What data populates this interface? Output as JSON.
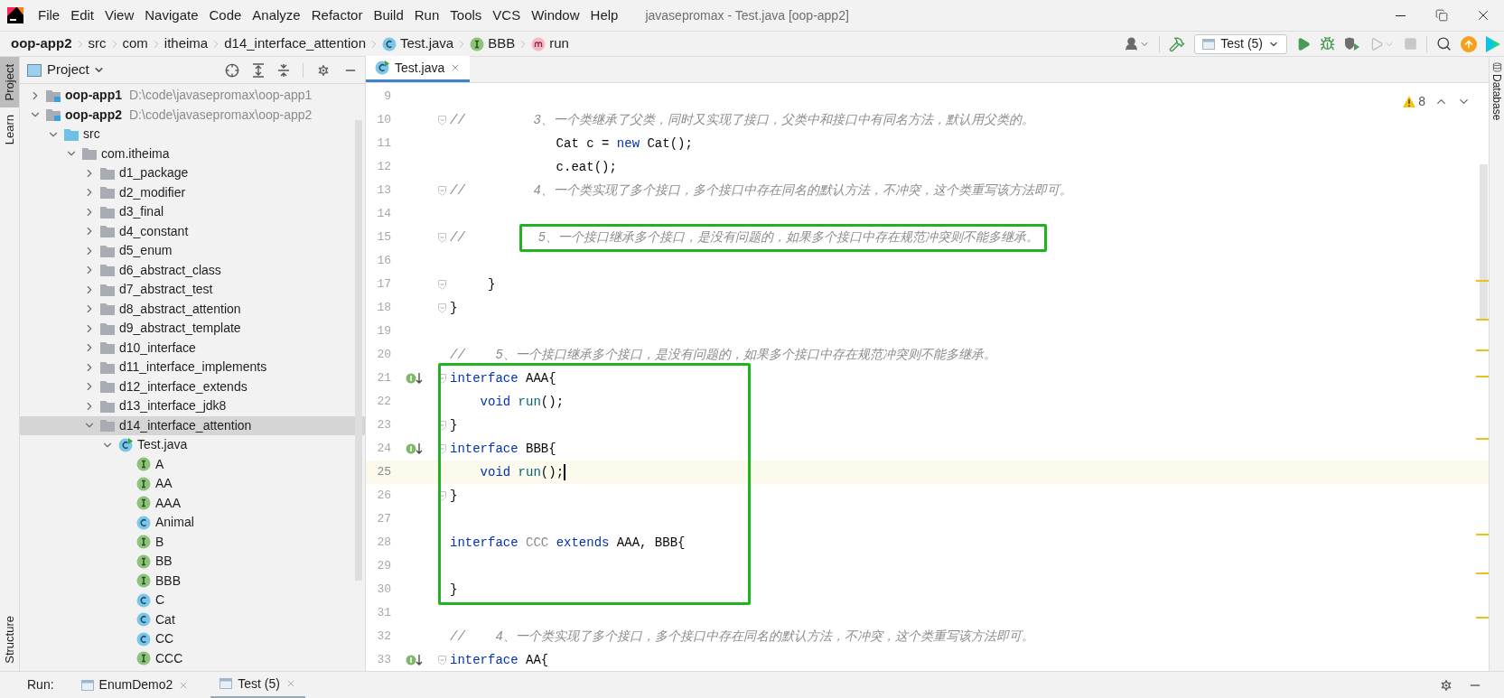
{
  "menu": [
    "File",
    "Edit",
    "View",
    "Navigate",
    "Code",
    "Analyze",
    "Refactor",
    "Build",
    "Run",
    "Tools",
    "VCS",
    "Window",
    "Help"
  ],
  "window": {
    "title": "javasepromax - Test.java [oop-app2]"
  },
  "breadcrumbs": [
    {
      "label": "oop-app2",
      "kind": "project"
    },
    {
      "label": "src",
      "kind": "folder"
    },
    {
      "label": "com",
      "kind": "folder"
    },
    {
      "label": "itheima",
      "kind": "folder"
    },
    {
      "label": "d14_interface_attention",
      "kind": "folder"
    },
    {
      "label": "Test.java",
      "kind": "class"
    },
    {
      "label": "BBB",
      "kind": "interface"
    },
    {
      "label": "run",
      "kind": "method"
    }
  ],
  "toolbar": {
    "run_config": "Test (5)"
  },
  "side_tabs": [
    {
      "label": "Project",
      "selected": true
    },
    {
      "label": "Learn",
      "selected": false
    }
  ],
  "side_tabs_bottom": [
    {
      "label": "Structure",
      "selected": false
    }
  ],
  "right_tabs": [
    {
      "label": "Database",
      "selected": false
    }
  ],
  "project_panel": {
    "title": "Project",
    "tree": [
      {
        "label": "oop-app1",
        "path": "D:\\code\\javasepromax\\oop-app1",
        "kind": "module",
        "expanded": false,
        "selected": false
      },
      {
        "label": "oop-app2",
        "path": "D:\\code\\javasepromax\\oop-app2",
        "kind": "module",
        "expanded": true,
        "selected": false,
        "children": [
          {
            "label": "src",
            "kind": "source",
            "expanded": true,
            "selected": false,
            "children": [
              {
                "label": "com.itheima",
                "kind": "package",
                "expanded": true,
                "selected": false,
                "children": [
                  {
                    "label": "d1_package",
                    "kind": "package",
                    "expanded": false,
                    "selected": false
                  },
                  {
                    "label": "d2_modifier",
                    "kind": "package",
                    "expanded": false,
                    "selected": false
                  },
                  {
                    "label": "d3_final",
                    "kind": "package",
                    "expanded": false,
                    "selected": false
                  },
                  {
                    "label": "d4_constant",
                    "kind": "package",
                    "expanded": false,
                    "selected": false
                  },
                  {
                    "label": "d5_enum",
                    "kind": "package",
                    "expanded": false,
                    "selected": false
                  },
                  {
                    "label": "d6_abstract_class",
                    "kind": "package",
                    "expanded": false,
                    "selected": false
                  },
                  {
                    "label": "d7_abstract_test",
                    "kind": "package",
                    "expanded": false,
                    "selected": false
                  },
                  {
                    "label": "d8_abstract_attention",
                    "kind": "package",
                    "expanded": false,
                    "selected": false
                  },
                  {
                    "label": "d9_abstract_template",
                    "kind": "package",
                    "expanded": false,
                    "selected": false
                  },
                  {
                    "label": "d10_interface",
                    "kind": "package",
                    "expanded": false,
                    "selected": false
                  },
                  {
                    "label": "d11_interface_implements",
                    "kind": "package",
                    "expanded": false,
                    "selected": false
                  },
                  {
                    "label": "d12_interface_extends",
                    "kind": "package",
                    "expanded": false,
                    "selected": false
                  },
                  {
                    "label": "d13_interface_jdk8",
                    "kind": "package",
                    "expanded": false,
                    "selected": false
                  },
                  {
                    "label": "d14_interface_attention",
                    "kind": "package",
                    "expanded": true,
                    "selected": true,
                    "children": [
                      {
                        "label": "Test.java",
                        "kind": "class-file",
                        "expanded": true,
                        "selected": false,
                        "children": [
                          {
                            "label": "A",
                            "kind": "interface",
                            "selected": false
                          },
                          {
                            "label": "AA",
                            "kind": "interface",
                            "selected": false
                          },
                          {
                            "label": "AAA",
                            "kind": "interface",
                            "selected": false
                          },
                          {
                            "label": "Animal",
                            "kind": "class",
                            "selected": false
                          },
                          {
                            "label": "B",
                            "kind": "interface",
                            "selected": false
                          },
                          {
                            "label": "BB",
                            "kind": "interface",
                            "selected": false
                          },
                          {
                            "label": "BBB",
                            "kind": "interface",
                            "selected": false
                          },
                          {
                            "label": "C",
                            "kind": "class",
                            "selected": false
                          },
                          {
                            "label": "Cat",
                            "kind": "class",
                            "selected": false
                          },
                          {
                            "label": "CC",
                            "kind": "class",
                            "selected": false
                          },
                          {
                            "label": "CCC",
                            "kind": "interface",
                            "selected": false
                          }
                        ]
                      }
                    ]
                  }
                ]
              }
            ]
          }
        ]
      }
    ]
  },
  "editor": {
    "tabs": [
      {
        "label": "Test.java",
        "selected": true
      }
    ],
    "warnings": "8",
    "blocks": [
      {
        "lines": [
          {
            "number": "9"
          },
          {
            "number": "10",
            "fold": true,
            "tokens": [
              {
                "kind": "comment",
                "text": "//         3、一个类继承了父类，同时又实现了接口，父类中和接口中有同名方法，默认用父类的。"
              }
            ]
          },
          {
            "number": "11",
            "tokens": [
              {
                "kind": "plain",
                "text": "              Cat c = "
              },
              {
                "kind": "keyword",
                "text": "new"
              },
              {
                "kind": "plain",
                "text": " Cat();"
              }
            ]
          },
          {
            "number": "12",
            "tokens": [
              {
                "kind": "plain",
                "text": "              c.eat();"
              }
            ]
          },
          {
            "number": "13",
            "fold": true,
            "tokens": [
              {
                "kind": "comment",
                "text": "//         4、一个类实现了多个接口，多个接口中存在同名的默认方法，不冲突，这个类重写该方法即可。"
              }
            ]
          },
          {
            "number": "14"
          },
          {
            "number": "15",
            "fold": true,
            "tokens": [
              {
                "kind": "comment",
                "text": "//"
              },
              {
                "kind": "comment",
                "boxed": true,
                "text": "5、一个接口继承多个接口，是没有问题的，如果多个接口中存在规范冲突则不能多继承。"
              }
            ]
          },
          {
            "number": "16"
          },
          {
            "number": "17",
            "fold": true,
            "tokens": [
              {
                "kind": "plain",
                "text": "     }"
              }
            ]
          },
          {
            "number": "18",
            "fold": true,
            "tokens": [
              {
                "kind": "plain",
                "text": "}"
              }
            ]
          },
          {
            "number": "19"
          },
          {
            "number": "20",
            "tokens": [
              {
                "kind": "comment",
                "text": "//    5、一个接口继承多个接口，是没有问题的，如果多个接口中存在规范冲突则不能多继承。"
              }
            ]
          }
        ]
      },
      {
        "boxed": true,
        "lines": [
          {
            "number": "21",
            "fold": true,
            "implemented": true,
            "tokens": [
              {
                "kind": "keyword",
                "text": "interface"
              },
              {
                "kind": "plain",
                "text": " AAA{"
              }
            ]
          },
          {
            "number": "22",
            "tokens": [
              {
                "kind": "keyword",
                "text": "    void"
              },
              {
                "kind": "method",
                "text": " run"
              },
              {
                "kind": "plain",
                "text": "();"
              }
            ]
          },
          {
            "number": "23",
            "fold": true,
            "tokens": [
              {
                "kind": "plain",
                "text": "}"
              }
            ]
          },
          {
            "number": "24",
            "fold": true,
            "implemented": true,
            "tokens": [
              {
                "kind": "keyword",
                "text": "interface"
              },
              {
                "kind": "plain",
                "text": " BBB{"
              }
            ]
          },
          {
            "number": "25",
            "current": true,
            "caret": true,
            "tokens": [
              {
                "kind": "keyword",
                "text": "    void"
              },
              {
                "kind": "method",
                "text": " run"
              },
              {
                "kind": "plain",
                "text": "();"
              }
            ]
          },
          {
            "number": "26",
            "fold": true,
            "tokens": [
              {
                "kind": "plain",
                "text": "}"
              }
            ]
          },
          {
            "number": "27"
          },
          {
            "number": "28",
            "tokens": [
              {
                "kind": "keyword",
                "text": "interface"
              },
              {
                "kind": "unused",
                "text": " CCC"
              },
              {
                "kind": "keyword",
                "text": " extends"
              },
              {
                "kind": "plain",
                "text": " AAA, BBB{"
              }
            ]
          },
          {
            "number": "29"
          },
          {
            "number": "30",
            "tokens": [
              {
                "kind": "plain",
                "text": "}"
              }
            ]
          }
        ]
      },
      {
        "lines": [
          {
            "number": "31"
          },
          {
            "number": "32",
            "tokens": [
              {
                "kind": "comment",
                "text": "//    4、一个类实现了多个接口，多个接口中存在同名的默认方法，不冲突，这个类重写该方法即可。"
              }
            ]
          },
          {
            "number": "33",
            "fold": true,
            "implemented": true,
            "tokens": [
              {
                "kind": "keyword",
                "text": "interface"
              },
              {
                "kind": "plain",
                "text": " AA{"
              }
            ]
          }
        ]
      }
    ]
  },
  "run_bar": {
    "label": "Run:",
    "tabs": [
      {
        "label": "EnumDemo2",
        "selected": false
      },
      {
        "label": "Test (5)",
        "selected": true
      }
    ]
  }
}
